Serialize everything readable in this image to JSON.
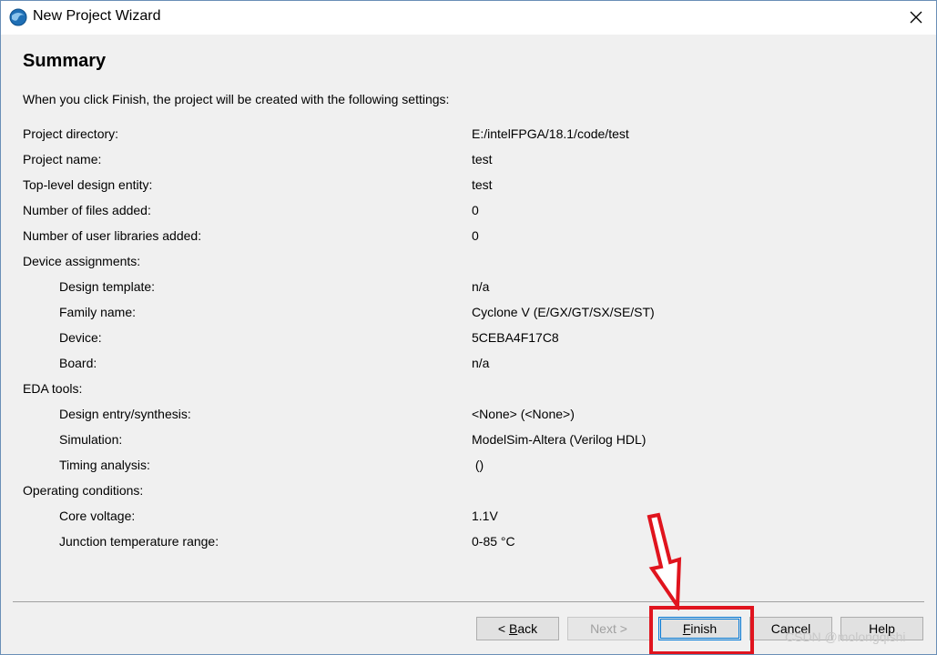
{
  "window": {
    "title": "New Project Wizard",
    "close_glyph": "✕"
  },
  "page": {
    "heading": "Summary",
    "intro": "When you click Finish, the project will be created with the following settings:"
  },
  "settings": [
    {
      "label": "Project directory:",
      "value": "E:/intelFPGA/18.1/code/test",
      "indent": false
    },
    {
      "label": "Project name:",
      "value": "test",
      "indent": false
    },
    {
      "label": "Top-level design entity:",
      "value": "test",
      "indent": false
    },
    {
      "label": "Number of files added:",
      "value": "0",
      "indent": false
    },
    {
      "label": "Number of user libraries added:",
      "value": "0",
      "indent": false
    },
    {
      "label": "Device assignments:",
      "value": "",
      "indent": false
    },
    {
      "label": "Design template:",
      "value": "n/a",
      "indent": true
    },
    {
      "label": "Family name:",
      "value": "Cyclone V (E/GX/GT/SX/SE/ST)",
      "indent": true
    },
    {
      "label": "Device:",
      "value": "5CEBA4F17C8",
      "indent": true
    },
    {
      "label": "Board:",
      "value": "n/a",
      "indent": true
    },
    {
      "label": "EDA tools:",
      "value": "",
      "indent": false
    },
    {
      "label": "Design entry/synthesis:",
      "value": "<None> (<None>)",
      "indent": true
    },
    {
      "label": "Simulation:",
      "value": "ModelSim-Altera (Verilog HDL)",
      "indent": true
    },
    {
      "label": "Timing analysis:",
      "value": " ()",
      "indent": true
    },
    {
      "label": "Operating conditions:",
      "value": "",
      "indent": false
    },
    {
      "label": "Core voltage:",
      "value": "1.1V",
      "indent": true
    },
    {
      "label": "Junction temperature range:",
      "value": "0-85 °C",
      "indent": true
    }
  ],
  "buttons": {
    "back": {
      "prefix": "< ",
      "accel": "B",
      "rest": "ack"
    },
    "next": "Next >",
    "finish": {
      "accel": "F",
      "rest": "inish"
    },
    "cancel": "Cancel",
    "help": "Help"
  },
  "watermark": "CSDN @molongqishi",
  "colors": {
    "annotation_red": "#e0141e",
    "focus_blue": "#0078d7"
  },
  "icons": {
    "app": "quartus-globe-icon",
    "close": "close-icon"
  }
}
